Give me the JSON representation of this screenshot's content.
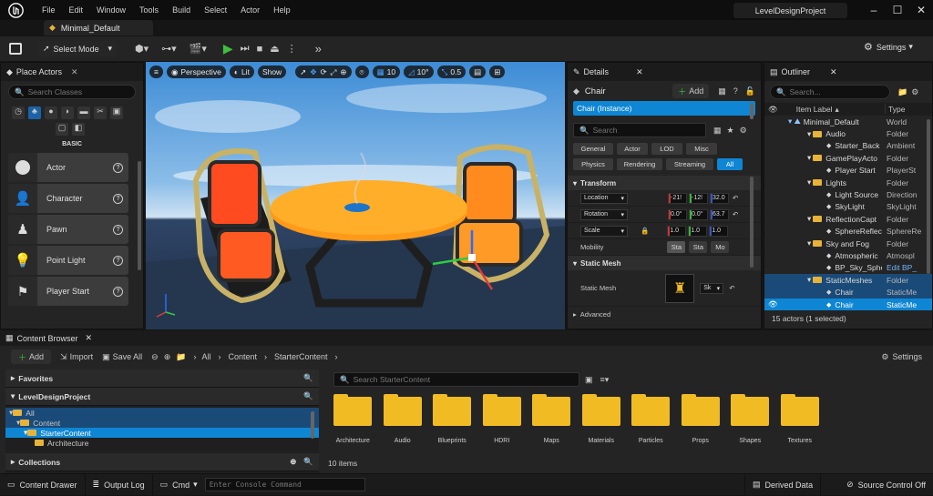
{
  "app": {
    "project_tab": "Minimal_Default",
    "project_name": "LevelDesignProject",
    "menu": [
      "File",
      "Edit",
      "Window",
      "Tools",
      "Build",
      "Select",
      "Actor",
      "Help"
    ]
  },
  "toolbar": {
    "select_mode": "Select Mode",
    "settings": "Settings"
  },
  "place_actors": {
    "tab": "Place Actors",
    "search_placeholder": "Search Classes",
    "category_label": "BASIC",
    "items": [
      "Actor",
      "Character",
      "Pawn",
      "Point Light",
      "Player Start"
    ]
  },
  "viewport": {
    "perspective": "Perspective",
    "lit": "Lit",
    "show": "Show",
    "grid_size": "10",
    "rotation_snap": "10°",
    "scale_snap": "0.5"
  },
  "details": {
    "tab": "Details",
    "actor_name": "Chair",
    "add": "Add",
    "instance": "Chair (Instance)",
    "search_placeholder": "Search",
    "filters_row1": [
      "General",
      "Actor",
      "LOD",
      "Misc"
    ],
    "filters_row2": [
      "Physics",
      "Rendering",
      "Streaming",
      "All"
    ],
    "section_transform": "Transform",
    "location_label": "Location",
    "rotation_label": "Rotation",
    "scale_label": "Scale",
    "location": [
      "-21!",
      "-12!",
      "32.0"
    ],
    "rotation": [
      "0.0°",
      "0.0°",
      "63.7"
    ],
    "scale": [
      "1.0",
      "1.0",
      "1.0"
    ],
    "mobility_label": "Mobility",
    "mobility": [
      "Sta",
      "Sta",
      "Mo"
    ],
    "section_static_mesh": "Static Mesh",
    "static_mesh_label": "Static Mesh",
    "static_mesh_value": "Sk",
    "advanced": "Advanced"
  },
  "outliner": {
    "tab": "Outliner",
    "search_placeholder": "Search...",
    "col_label": "Item Label",
    "col_type": "Type",
    "rows": [
      {
        "label": "Minimal_Default",
        "type": "World"
      },
      {
        "label": "Audio",
        "type": "Folder"
      },
      {
        "label": "Starter_Back",
        "type": "Ambient"
      },
      {
        "label": "GamePlayActo",
        "type": "Folder"
      },
      {
        "label": "Player Start",
        "type": "PlayerSt"
      },
      {
        "label": "Lights",
        "type": "Folder"
      },
      {
        "label": "Light Source",
        "type": "Direction"
      },
      {
        "label": "SkyLight",
        "type": "SkyLight"
      },
      {
        "label": "ReflectionCapt",
        "type": "Folder"
      },
      {
        "label": "SphereReflec",
        "type": "SphereRe"
      },
      {
        "label": "Sky and Fog",
        "type": "Folder"
      },
      {
        "label": "Atmospheric",
        "type": "Atmospl"
      },
      {
        "label": "BP_Sky_Sphe",
        "type": "Edit BP_"
      },
      {
        "label": "StaticMeshes",
        "type": "Folder"
      },
      {
        "label": "Chair",
        "type": "StaticMe"
      },
      {
        "label": "Chair",
        "type": "StaticMe"
      }
    ],
    "footer": "15 actors (1 selected)"
  },
  "content_browser": {
    "tab": "Content Browser",
    "add": "Add",
    "import": "Import",
    "save_all": "Save All",
    "breadcrumb": [
      "All",
      "Content",
      "StarterContent"
    ],
    "settings": "Settings",
    "favorites": "Favorites",
    "project": "LevelDesignProject",
    "tree": [
      "All",
      "Content",
      "StarterContent",
      "Architecture"
    ],
    "collections": "Collections",
    "search_placeholder": "Search StarterContent",
    "folders": [
      "Architecture",
      "Audio",
      "Blueprints",
      "HDRI",
      "Maps",
      "Materials",
      "Particles",
      "Props",
      "Shapes",
      "Textures"
    ],
    "count": "10 items"
  },
  "statusbar": {
    "content_drawer": "Content Drawer",
    "output_log": "Output Log",
    "cmd": "Cmd",
    "console_placeholder": "Enter Console Command",
    "derived_data": "Derived Data",
    "source_control": "Source Control Off"
  },
  "colors": {
    "accent": "#0e86d4",
    "selection": "#1a63a8",
    "folder": "#f1bb24",
    "play": "#3fbf3f"
  }
}
